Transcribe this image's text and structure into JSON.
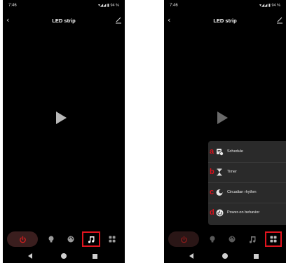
{
  "status": {
    "time": "7:46",
    "battery": "94 %"
  },
  "header": {
    "title": "LED strip",
    "back_icon": "chevron-left-icon",
    "edit_icon": "pencil-icon"
  },
  "tabs": [
    {
      "icon": "power-icon"
    },
    {
      "icon": "bulb-icon"
    },
    {
      "icon": "palette-icon"
    },
    {
      "icon": "music-icon"
    },
    {
      "icon": "grid-icon"
    }
  ],
  "menu": {
    "items": [
      {
        "marker": "a",
        "label": "Schedule",
        "icon": "schedule-icon"
      },
      {
        "marker": "b",
        "label": "Timer",
        "icon": "hourglass-icon"
      },
      {
        "marker": "c",
        "label": "Circadian rhythm",
        "icon": "circadian-icon"
      },
      {
        "marker": "d",
        "label": "Power-on behavior",
        "icon": "power-on-icon"
      }
    ]
  },
  "colors": {
    "accent_red": "#e0141e",
    "power_red": "#d01e1e",
    "background": "#000000",
    "menu_bg": "#2a2a2a"
  }
}
